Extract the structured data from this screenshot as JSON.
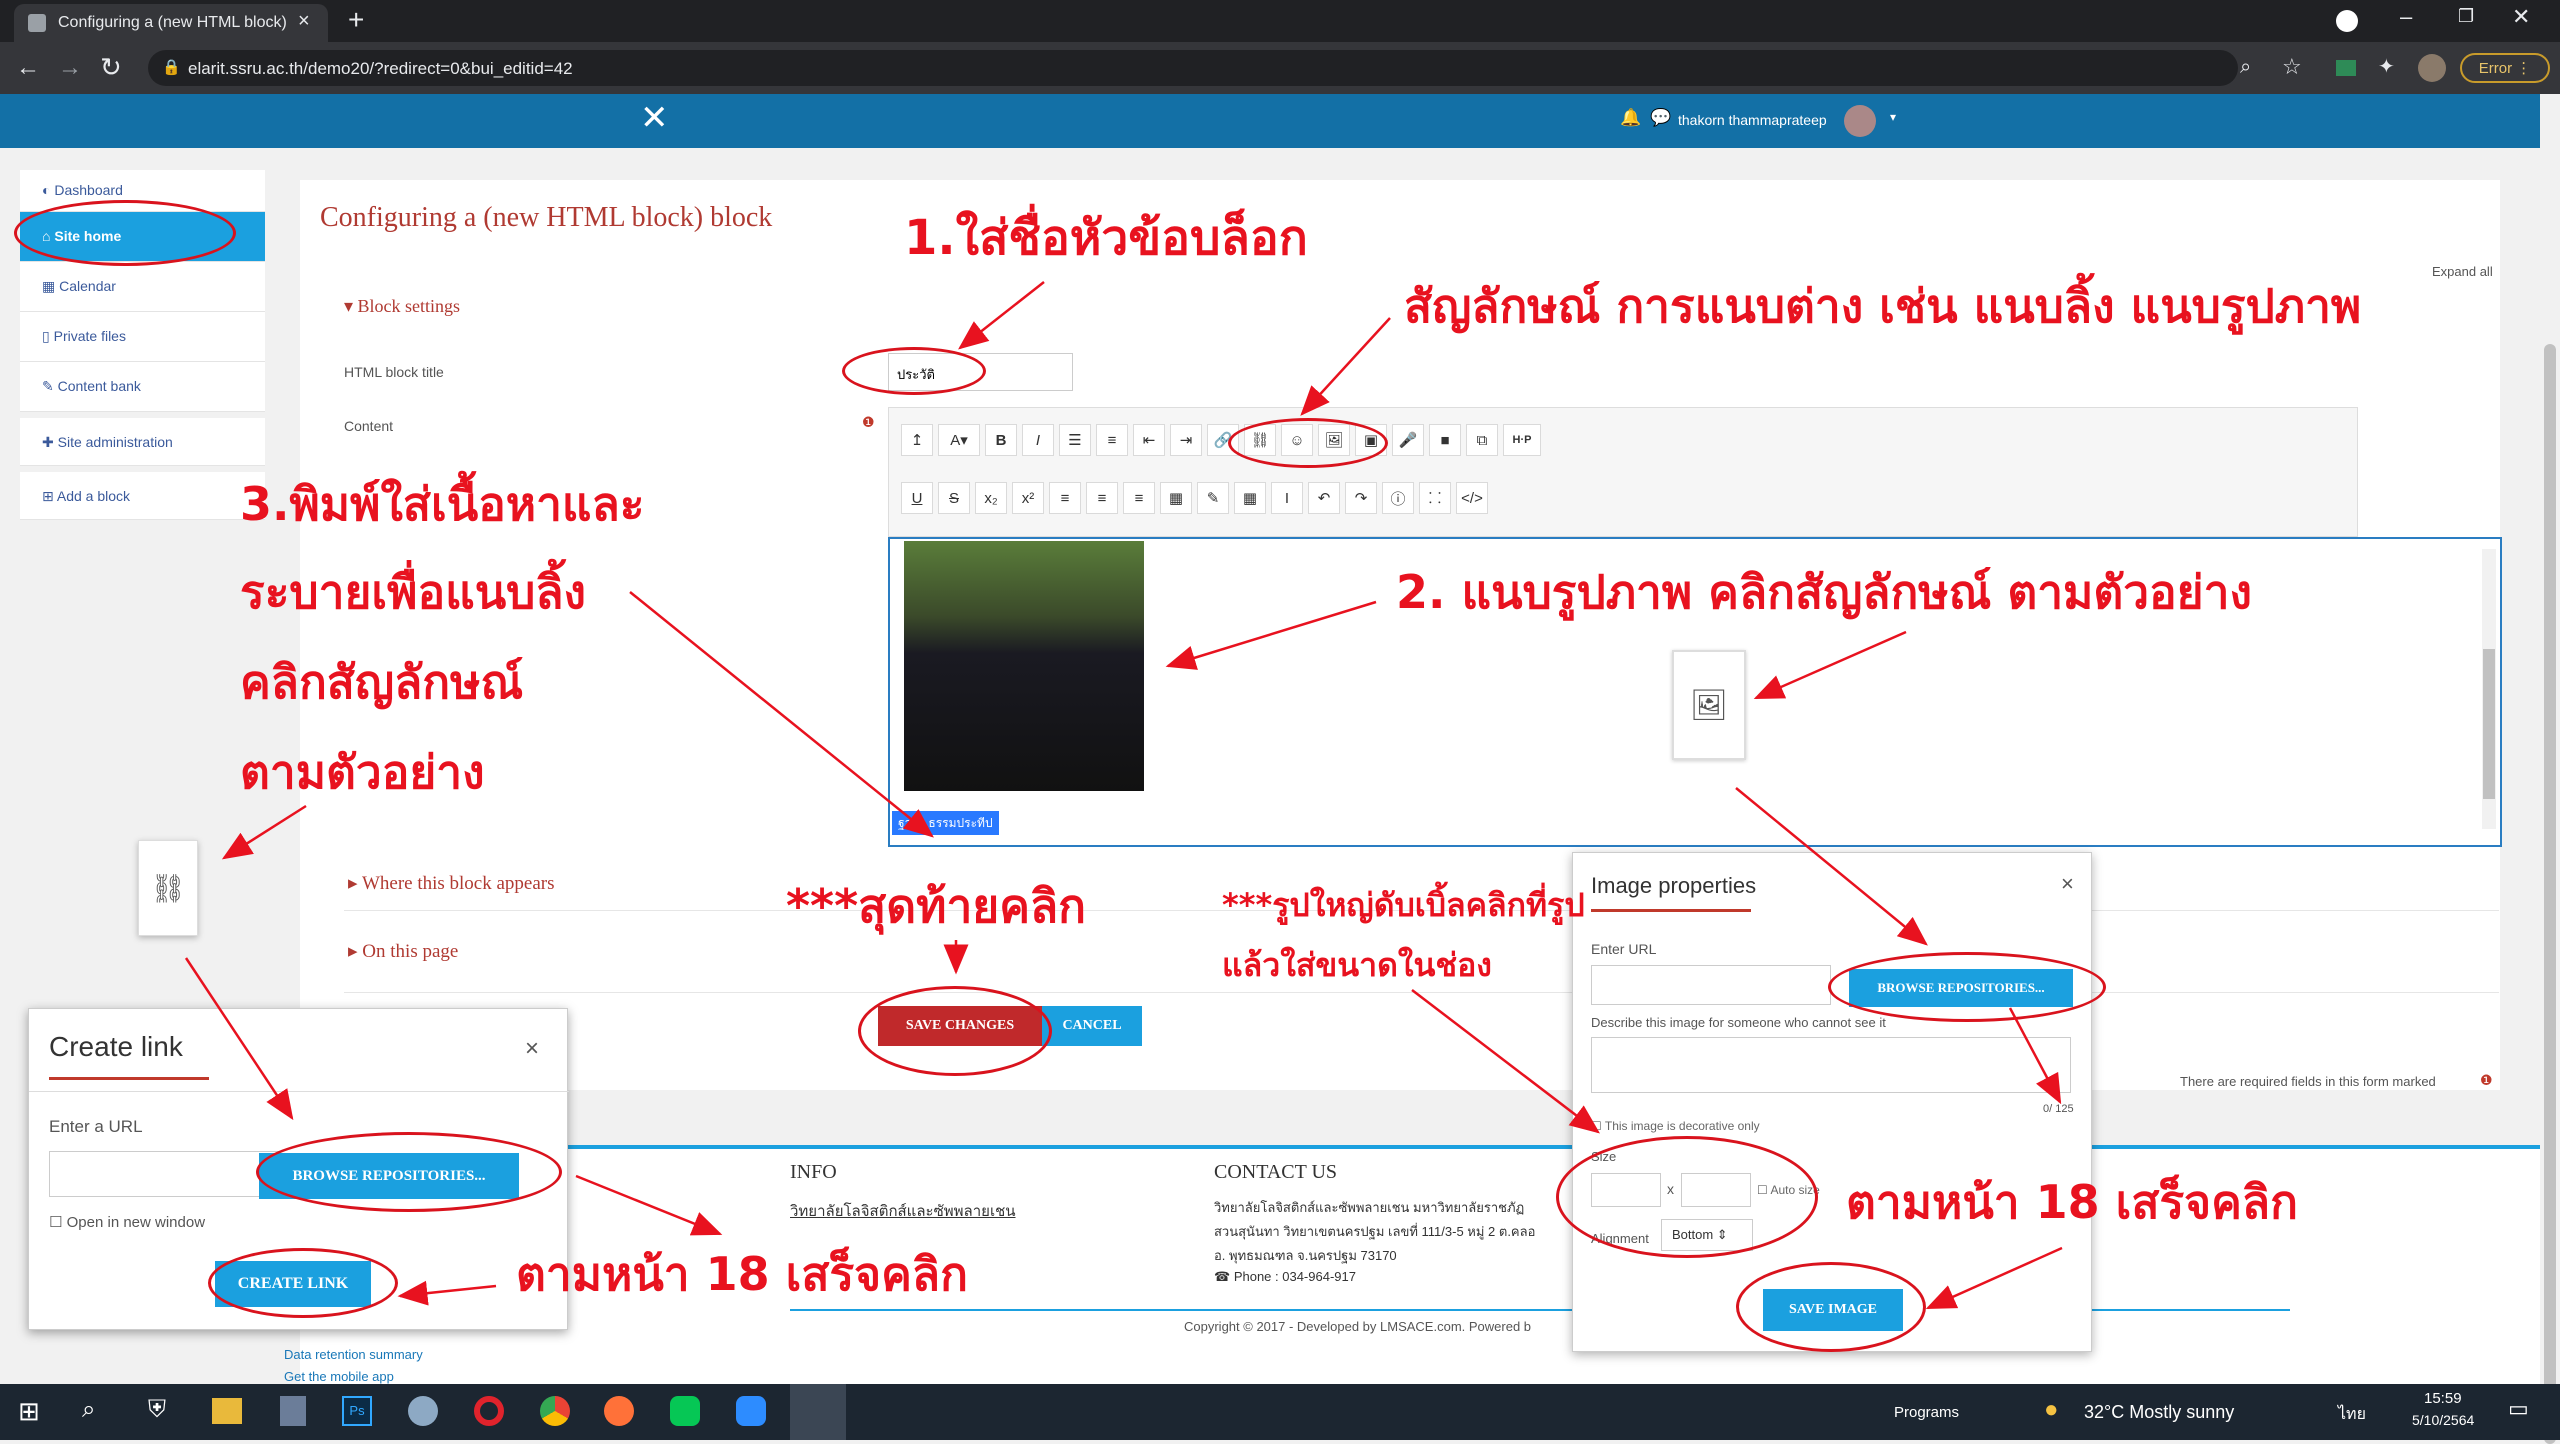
{
  "browser": {
    "tab_title": "Configuring a (new HTML block)",
    "url": "elarit.ssru.ac.th/demo20/?redirect=0&bui_editid=42",
    "error_badge": "Error"
  },
  "navbar": {
    "user": "thakorn thammaprateep"
  },
  "sidebar": {
    "items": [
      {
        "label": "Dashboard"
      },
      {
        "label": "Site home"
      },
      {
        "label": "Calendar"
      },
      {
        "label": "Private files"
      },
      {
        "label": "Content bank"
      },
      {
        "label": "Site administration"
      },
      {
        "label": "Add a block"
      }
    ]
  },
  "form": {
    "heading": "Configuring a (new HTML block) block",
    "expand_all": "Expand all",
    "block_settings": "Block settings",
    "title_label": "HTML block title",
    "title_value": "ประวัติ",
    "content_label": "Content",
    "where_appears": "Where this block appears",
    "on_this_page": "On this page",
    "save": "SAVE CHANGES",
    "cancel": "CANCEL",
    "required_note": "There are required fields in this form marked",
    "editor_text": "ฐากร ธรรมประทีป"
  },
  "toolbar": {
    "row1": [
      "↥",
      "A▾",
      "B",
      "I",
      "☰",
      "≡",
      "⇤",
      "⇥",
      "🔗",
      "⛓",
      "☺",
      "🖼",
      "▣",
      "🎤",
      "■",
      "⧉",
      "H·P"
    ],
    "row2": [
      "U",
      "S",
      "x₂",
      "x²",
      "≡",
      "≡",
      "≡",
      "▦",
      "✎",
      "▦",
      "I",
      "↶",
      "↷",
      "ⓘ",
      "⸬",
      "</>"
    ]
  },
  "footer": {
    "info_title": "INFO",
    "info_link": "วิทยาลัยโลจิสติกส์และซัพพลายเชน",
    "contact_title": "CONTACT US",
    "contact_l1": "วิทยาลัยโลจิสติกส์และซัพพลายเชน มหาวิทยาลัยราชภัฏ",
    "contact_l2": "สวนสุนันทา วิทยาเขตนครปฐม เลขที่ 111/3-5 หมู่ 2 ต.คลอ",
    "contact_l3": "อ. พุทธมณฑล จ.นครปฐม 73170",
    "phone": "Phone : 034-964-917",
    "copyright": "Copyright © 2017 - Developed by LMSACE.com. Powered b",
    "data_retention": "Data retention summary",
    "mobile_app": "Get the mobile app"
  },
  "create_link": {
    "title": "Create link",
    "url_label": "Enter a URL",
    "browse": "BROWSE REPOSITORIES...",
    "new_window": "Open in new window",
    "create": "CREATE LINK"
  },
  "image_props": {
    "title": "Image properties",
    "url_label": "Enter URL",
    "browse": "BROWSE REPOSITORIES...",
    "describe": "Describe this image for someone who cannot see it",
    "counter": "0/ 125",
    "decorative": "This image is decorative only",
    "size": "Size",
    "x": "x",
    "auto_size": "Auto size",
    "alignment": "Alignment",
    "align_value": "Bottom",
    "save": "SAVE IMAGE"
  },
  "annotations": {
    "a1": "1.ใส่ชื่อหัวข้อบล็อก",
    "a_symbol": "สัญลักษณ์ การแนบต่าง เช่น แนบลิ้ง แนบรูปภาพ",
    "a2": "2. แนบรูปภาพ คลิกสัญลักษณ์ ตามตัวอย่าง",
    "a3_1": "3.พิมพ์ใส่เนื้อหาและ",
    "a3_2": "ระบายเพื่อแนบลิ้ง",
    "a3_3": "คลิกสัญลักษณ์",
    "a3_4": "ตามตัวอย่าง",
    "final": "***สุดท้ายคลิก",
    "big_img_1": "***รูปใหญ่ดับเบิ้ลคลิกที่รูป",
    "big_img_2": "แล้วใส่ขนาดในช่อง",
    "page18_a": "ตามหน้า 18 เสร็จคลิก",
    "page18_b": "ตามหน้า 18 เสร็จคลิก"
  },
  "taskbar": {
    "programs": "Programs",
    "weather": "32°C  Mostly sunny",
    "lang": "ไทย",
    "time": "15:59",
    "date": "5/10/2564"
  }
}
